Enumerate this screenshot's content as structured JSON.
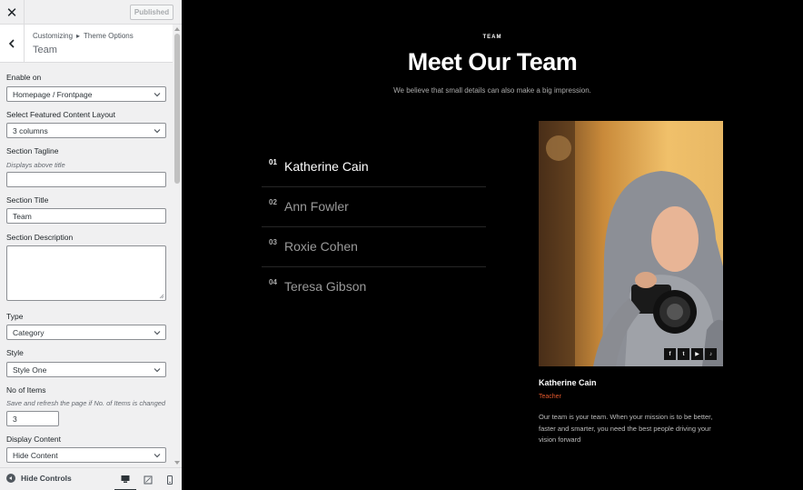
{
  "sidebar": {
    "publish_label": "Published",
    "breadcrumb": {
      "root": "Customizing",
      "separator": "▸",
      "parent": "Theme Options"
    },
    "section_title": "Team",
    "controls": {
      "enable_on": {
        "label": "Enable on",
        "value": "Homepage / Frontpage"
      },
      "layout": {
        "label": "Select Featured Content Layout",
        "value": "3 columns"
      },
      "tagline": {
        "label": "Section Tagline",
        "description": "Displays above title",
        "value": ""
      },
      "title": {
        "label": "Section Title",
        "value": "Team"
      },
      "description": {
        "label": "Section Description",
        "value": ""
      },
      "type": {
        "label": "Type",
        "value": "Category"
      },
      "style": {
        "label": "Style",
        "value": "Style One"
      },
      "items": {
        "label": "No of Items",
        "description": "Save and refresh the page if No. of Items is changed",
        "value": "3"
      },
      "display_content": {
        "label": "Display Content",
        "value": "Hide Content"
      }
    },
    "footer": {
      "hide_controls_label": "Hide Controls"
    }
  },
  "preview": {
    "tagline": "TEAM",
    "title": "Meet Our Team",
    "subtitle": "We believe that small details can also make a big impression.",
    "members": [
      {
        "num": "01",
        "name": "Katherine Cain",
        "active": true
      },
      {
        "num": "02",
        "name": "Ann Fowler",
        "active": false
      },
      {
        "num": "03",
        "name": "Roxie Cohen",
        "active": false
      },
      {
        "num": "04",
        "name": "Teresa Gibson",
        "active": false
      }
    ],
    "socials": [
      "f",
      "t",
      "▶",
      "♪"
    ],
    "card": {
      "name": "Katherine Cain",
      "role": "Teacher",
      "bio": "Our team is your team. When your mission is to be better, faster and smarter, you need the best people driving your vision forward"
    }
  },
  "colors": {
    "accent": "#e2572c",
    "sidebar_bg": "#f0f0f1",
    "preview_bg": "#000000"
  }
}
